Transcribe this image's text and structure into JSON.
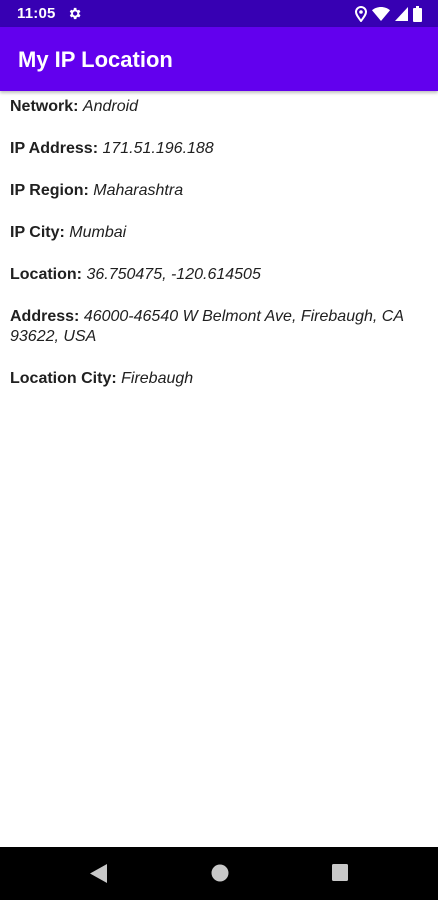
{
  "status_bar": {
    "time": "11:05",
    "icons": [
      "gear-icon",
      "location-icon",
      "wifi-icon",
      "signal-icon",
      "battery-icon"
    ]
  },
  "app_bar": {
    "title": "My IP Location",
    "color": "#6200ee",
    "status_color": "#3700b3"
  },
  "info": [
    {
      "label": "Network:",
      "value": "Android"
    },
    {
      "label": "IP Address:",
      "value": "171.51.196.188"
    },
    {
      "label": "IP Region:",
      "value": "Maharashtra"
    },
    {
      "label": "IP City:",
      "value": "Mumbai"
    },
    {
      "label": "Location:",
      "value": "36.750475, -120.614505"
    },
    {
      "label": "Address:",
      "value": "46000-46540 W Belmont Ave, Firebaugh, CA 93622, USA"
    },
    {
      "label": "Location City:",
      "value": "Firebaugh"
    }
  ],
  "nav_bar": {
    "icons": [
      "back-icon",
      "home-icon",
      "recents-icon"
    ]
  }
}
